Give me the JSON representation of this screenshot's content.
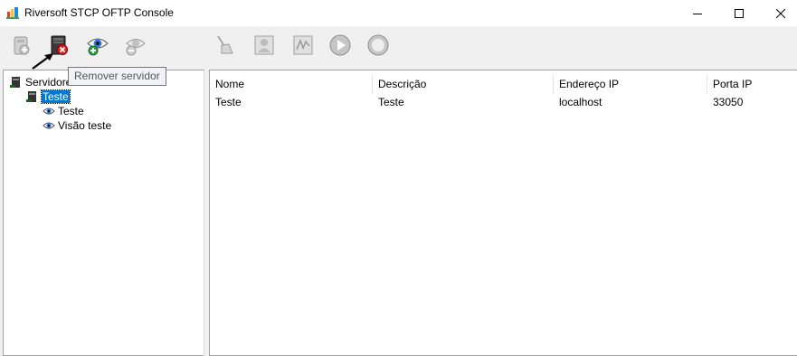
{
  "window": {
    "title": "Riversoft STCP OFTP Console",
    "icon": "app-icon"
  },
  "toolbar": {
    "buttons": [
      {
        "name": "add-server-button",
        "icon": "server-add-icon",
        "enabled": false
      },
      {
        "name": "remove-server-button",
        "icon": "server-remove-icon",
        "enabled": true
      },
      {
        "name": "add-view-button",
        "icon": "eye-add-icon",
        "enabled": true
      },
      {
        "name": "remove-view-button",
        "icon": "eye-remove-icon",
        "enabled": false
      },
      {
        "name": "clear-button",
        "icon": "broom-icon",
        "enabled": false
      },
      {
        "name": "user-button",
        "icon": "user-icon",
        "enabled": false
      },
      {
        "name": "signature-button",
        "icon": "signature-icon",
        "enabled": false
      },
      {
        "name": "start-button",
        "icon": "play-icon",
        "enabled": false
      },
      {
        "name": "stop-button",
        "icon": "stop-icon",
        "enabled": false
      }
    ],
    "tooltip": "Remover servidor"
  },
  "tree": {
    "root_label": "Servidores",
    "server_label": "Teste",
    "views": [
      "Teste",
      "Visão teste"
    ]
  },
  "list": {
    "columns": [
      "Nome",
      "Descrição",
      "Endereço IP",
      "Porta IP"
    ],
    "rows": [
      [
        "Teste",
        "Teste",
        "localhost",
        "33050"
      ]
    ]
  }
}
